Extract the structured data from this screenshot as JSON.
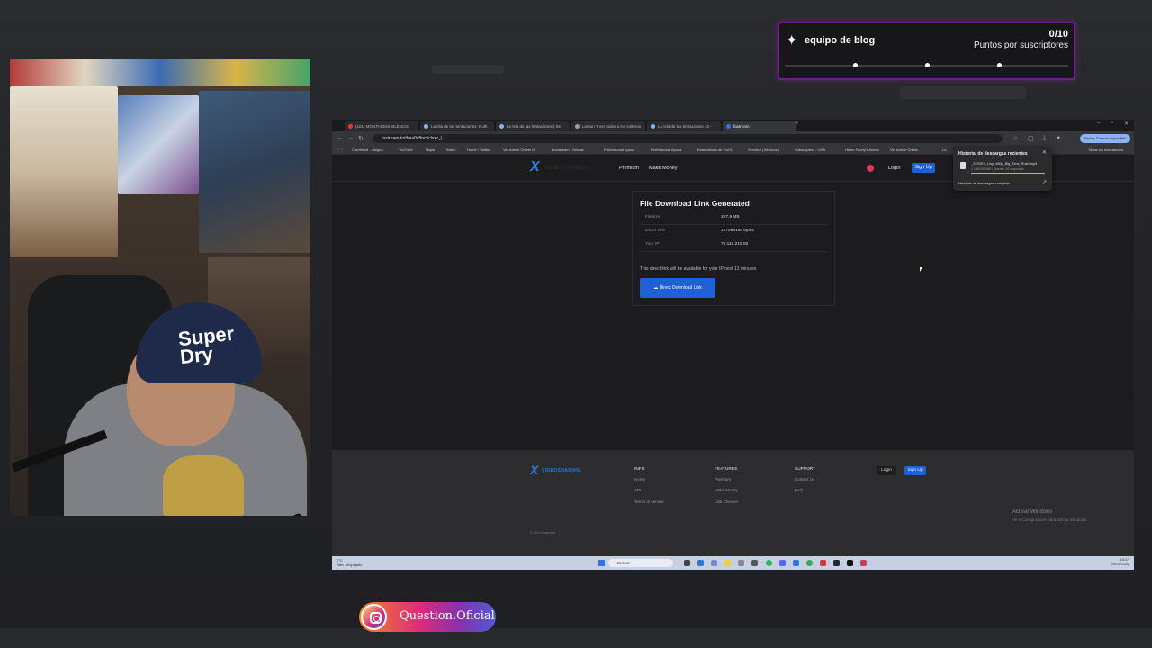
{
  "overlay": {
    "title": "equipo de blog",
    "count": "0/10",
    "subtitle": "Puntos por suscriptores",
    "progress": 0
  },
  "browser": {
    "tabs": [
      {
        "label": "(101) MONTAGEM SILENCIO",
        "color": "#e53935"
      },
      {
        "label": "La isla de las tentaciones: Ruth",
        "color": "#8ab4f8"
      },
      {
        "label": "La Isla de las tentaciones | Se",
        "color": "#8ab4f8"
      },
      {
        "label": "Lemon T ver todos a los solteros",
        "color": "#9e9e9e"
      },
      {
        "label": "La Isla de las tentaciones 10 -",
        "color": "#8ab4f8"
      },
      {
        "label": "fastream",
        "color": "#2b78e4"
      }
    ],
    "url": "fastream.to/d/aa0c8nc5clxxc_l",
    "chrome_update": "Nueva Chrome disponible",
    "bookmarks": [
      "Cameltoid - Jueguo",
      "YouTube",
      "Mapa",
      "Twitch",
      "Home / Twitter",
      "Ver Anime Online G",
      "Livestream - Descar",
      "Professional Apoca",
      "Professional Apoca",
      "Estadísticas de YouTu",
      "Servidor | Alternos |",
      "Subscription - CHA",
      "Helen Fanny's Anime",
      "Ver Anime Online -",
      "Lo",
      "Todos los marcadores"
    ]
  },
  "site": {
    "nav": {
      "premium": "Premium",
      "make_money": "Make Money",
      "login": "Login",
      "signup": "Sign Up"
    },
    "card": {
      "title": "File Download Link Generated",
      "rows": [
        {
          "label": "Filesize",
          "value": "207.9 MB"
        },
        {
          "label": "Exact size",
          "value": "217994168 bytes"
        },
        {
          "label": "Your IP",
          "value": "79.116.219.92"
        }
      ],
      "note": "This direct link will be available for your IP next 12 minutes",
      "button": "Direct Download Link"
    },
    "downloads_popup": {
      "title": "Historial de descargas recientes",
      "file": "_SERIES_Lisp_480p_Big_Time_Rush.mp4",
      "meta": "1 198/208 MB • Quedan 10 segundos",
      "all": "Historial de descargas completo"
    },
    "footer": {
      "logo_word": "VIDEOSHARING",
      "cols": [
        {
          "head": "INFO",
          "links": [
            "Home",
            "API",
            "Terms of service"
          ]
        },
        {
          "head": "FEATURES",
          "links": [
            "Premium",
            "Make Money",
            "Link Checker"
          ]
        },
        {
          "head": "SUPPORT",
          "links": [
            "Contact Us",
            "FAQ"
          ]
        }
      ],
      "login": "Login",
      "signup": "Sign Up",
      "copyright": "© 2024 fastream",
      "activate": "Activar Windows",
      "activate_sub": "Ve a Configuración para activar Windows."
    },
    "taskbar": {
      "weather_temp": "3°C",
      "weather_desc": "Niev. despejado",
      "search": "Buscar",
      "time": "18:37",
      "date": "29/03/2024"
    }
  },
  "instagram": {
    "handle": "Question.Oficial"
  },
  "colors": {
    "accent": "#1f5fd8",
    "overlay_border": "#6e1f8a"
  }
}
